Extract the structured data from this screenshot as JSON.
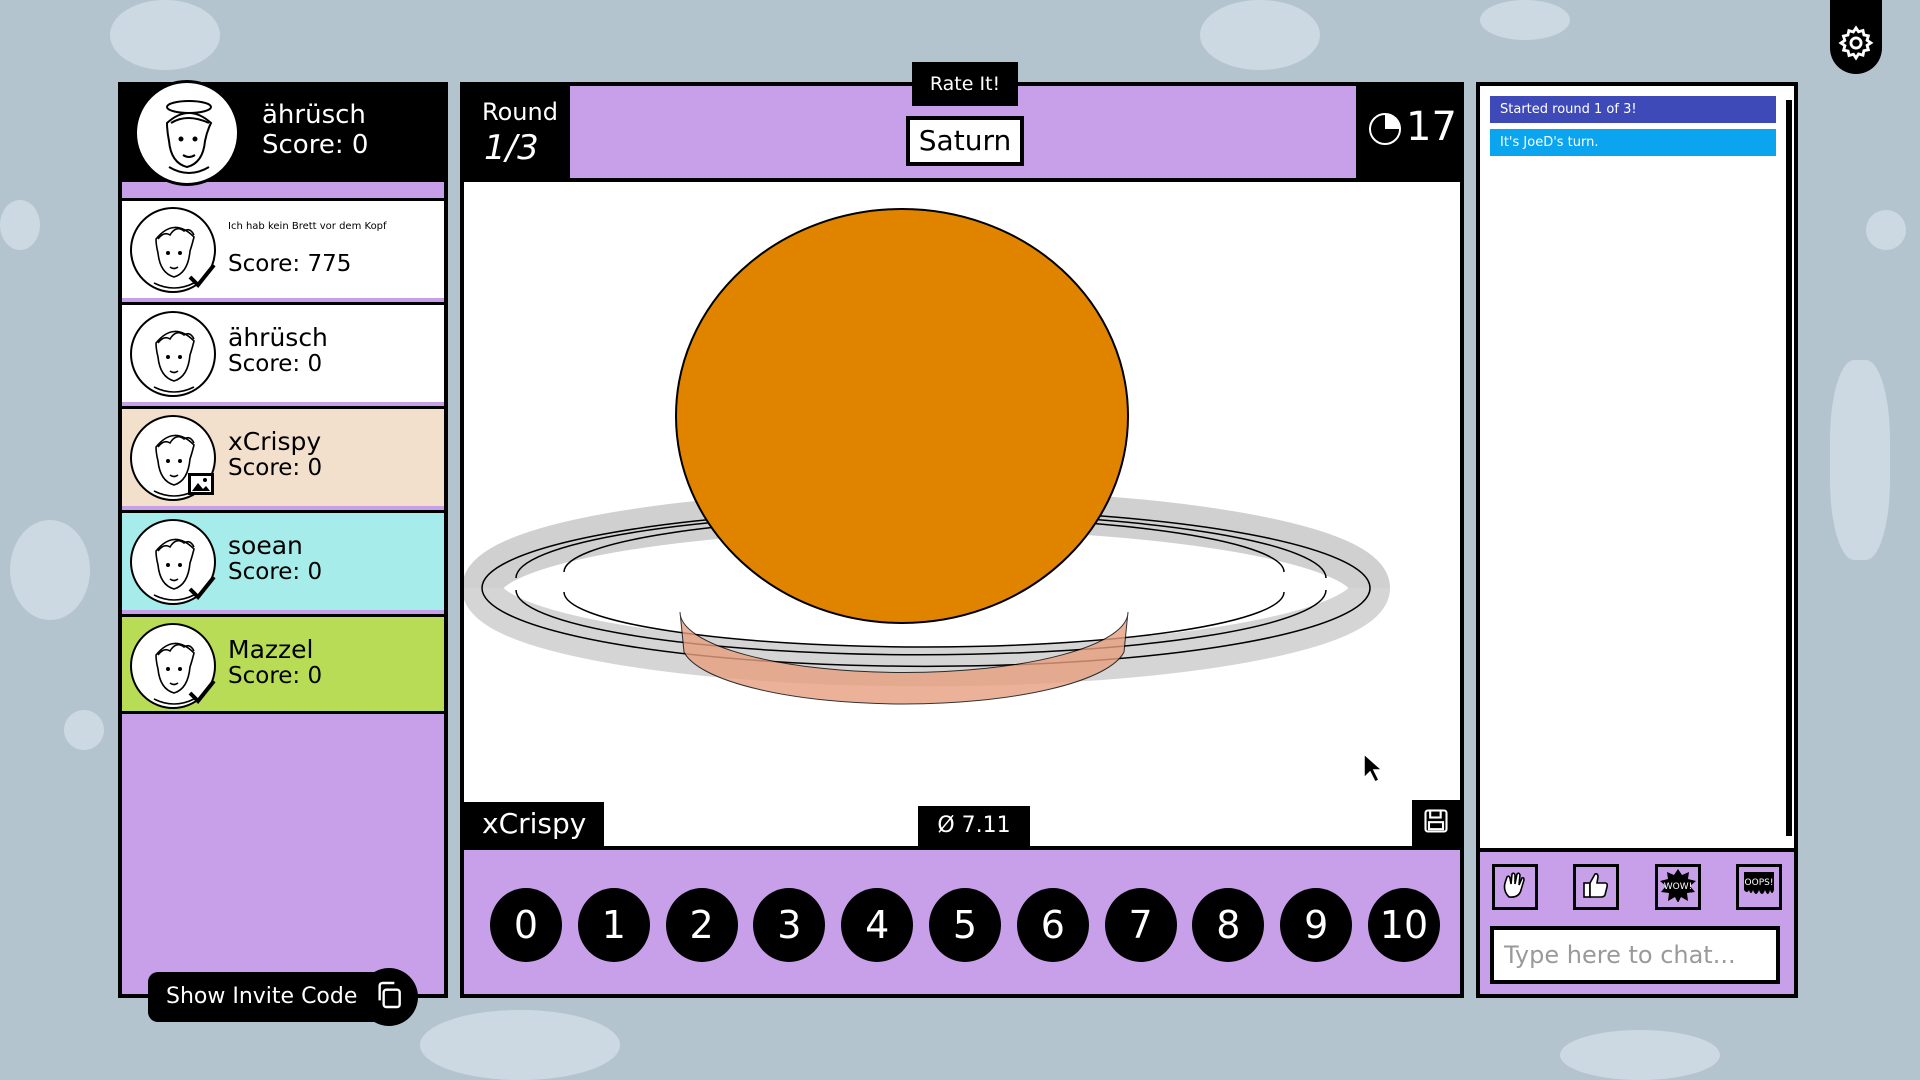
{
  "settings": {
    "icon": "gear-icon"
  },
  "current_player": {
    "name": "ährüsch",
    "score": "Score: 0"
  },
  "players": [
    {
      "name": "Ich hab kein Brett vor dem Kopf",
      "score": "Score: 775",
      "bg": "#ffffff",
      "status": "check"
    },
    {
      "name": "ährüsch",
      "score": "Score: 0",
      "bg": "#ffffff",
      "status": "none"
    },
    {
      "name": "xCrispy",
      "score": "Score: 0",
      "bg": "#f3e0cc",
      "status": "drawing"
    },
    {
      "name": "soean",
      "score": "Score: 0",
      "bg": "#a6ecea",
      "status": "check"
    },
    {
      "name": "Mazzel",
      "score": "Score: 0",
      "bg": "#b8dc56",
      "status": "check"
    }
  ],
  "invite": {
    "label": "Show Invite Code",
    "icon": "copy-icon"
  },
  "round": {
    "label": "Round",
    "value": "1/3"
  },
  "rate_tab": "Rate It!",
  "word": "Saturn",
  "timer": {
    "value": "17",
    "icon": "pie-timer-icon"
  },
  "canvas": {
    "artist": "xCrispy",
    "average": "Ø 7.11",
    "save_icon": "floppy-disk-icon"
  },
  "colors": {
    "accent": "#c8a0ea",
    "background": "#b4c4cf",
    "planet": "#e08400",
    "ring": "#d0d0d0",
    "chat_blue": "#3e4ab8",
    "chat_cyan": "#0aa4ef"
  },
  "rating_options": [
    "0",
    "1",
    "2",
    "3",
    "4",
    "5",
    "6",
    "7",
    "8",
    "9",
    "10"
  ],
  "chat": {
    "messages": [
      {
        "text": "Started round 1 of 3!",
        "color": "#3e4ab8"
      },
      {
        "text": "It's JoeD's turn.",
        "color": "#0aa4ef"
      }
    ],
    "reactions": [
      "wave-icon",
      "thumbs-up-icon",
      "wow-icon",
      "oops-icon"
    ],
    "placeholder": "Type here to chat..."
  }
}
